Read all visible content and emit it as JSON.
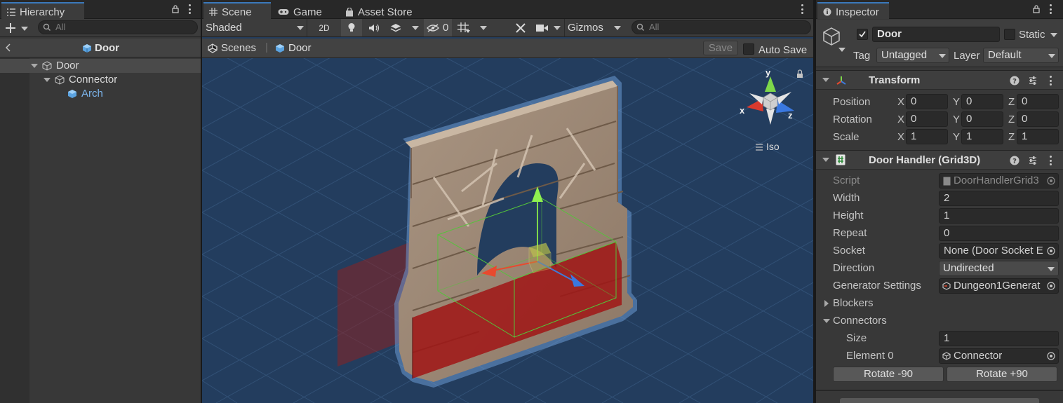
{
  "hierarchy": {
    "tab_label": "Hierarchy",
    "search_placeholder": "All",
    "breadcrumb": "Door",
    "items": [
      {
        "label": "Door"
      },
      {
        "label": "Connector"
      },
      {
        "label": "Arch"
      }
    ]
  },
  "scene": {
    "tabs": [
      {
        "label": "Scene"
      },
      {
        "label": "Game"
      },
      {
        "label": "Asset Store"
      }
    ],
    "shading_mode": "Shaded",
    "toggle_2d": "2D",
    "hidden_count": "0",
    "gizmos_label": "Gizmos",
    "search_placeholder": "All",
    "breadcrumb": {
      "scenes": "Scenes",
      "current": "Door"
    },
    "save_label": "Save",
    "auto_save_label": "Auto Save",
    "gizmo_axes": {
      "x": "x",
      "y": "y",
      "z": "z"
    },
    "projection_label": "Iso"
  },
  "inspector": {
    "tab_label": "Inspector",
    "object_name": "Door",
    "static_label": "Static",
    "tag_label": "Tag",
    "tag_value": "Untagged",
    "layer_label": "Layer",
    "layer_value": "Default",
    "transform": {
      "title": "Transform",
      "rows": [
        {
          "label": "Position",
          "x": "0",
          "y": "0",
          "z": "0"
        },
        {
          "label": "Rotation",
          "x": "0",
          "y": "0",
          "z": "0"
        },
        {
          "label": "Scale",
          "x": "1",
          "y": "1",
          "z": "1"
        }
      ],
      "axis": {
        "x": "X",
        "y": "Y",
        "z": "Z"
      }
    },
    "door_handler": {
      "title": "Door Handler (Grid3D)",
      "script_label": "Script",
      "script_value": "DoorHandlerGrid3",
      "width_label": "Width",
      "width_value": "2",
      "height_label": "Height",
      "height_value": "1",
      "repeat_label": "Repeat",
      "repeat_value": "0",
      "socket_label": "Socket",
      "socket_value": "None (Door Socket E",
      "direction_label": "Direction",
      "direction_value": "Undirected",
      "generator_label": "Generator Settings",
      "generator_value": "Dungeon1Generat",
      "blockers_label": "Blockers",
      "connectors_label": "Connectors",
      "size_label": "Size",
      "size_value": "1",
      "element0_label": "Element 0",
      "element0_value": "Connector",
      "rotate_neg_label": "Rotate -90",
      "rotate_pos_label": "Rotate +90"
    }
  },
  "colors": {
    "accent": "#3a79bb",
    "scene_bg": "#233d5e",
    "selection": "#2c5d87",
    "prefab_blue": "#7cb5ec"
  }
}
